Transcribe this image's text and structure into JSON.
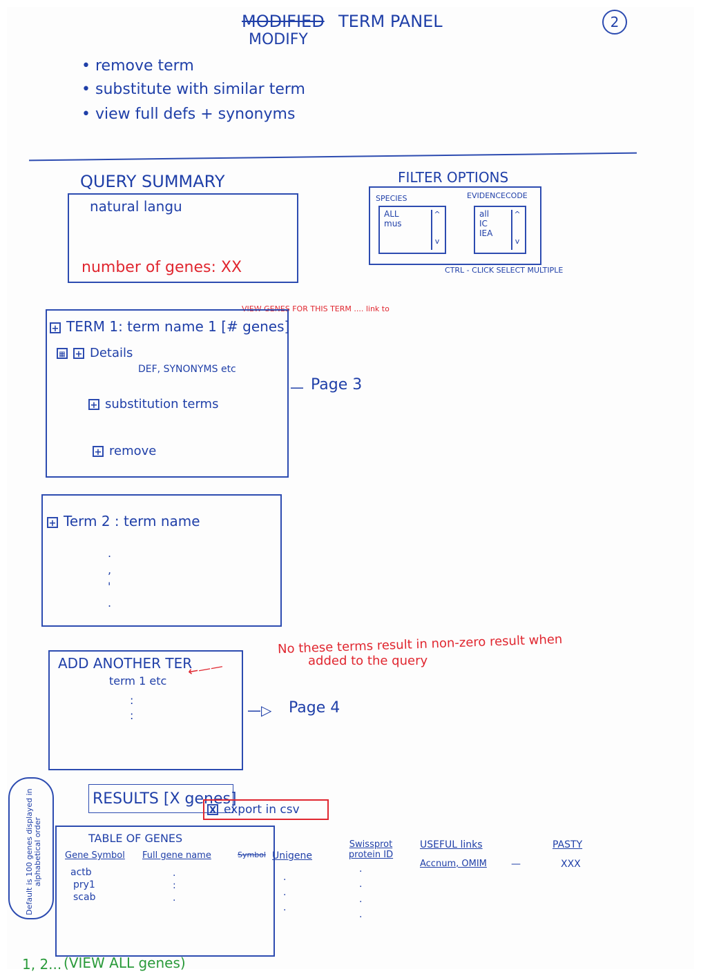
{
  "header": {
    "title_struck": "MODIFIED",
    "title_rest": "TERM PANEL",
    "subtitle": "MODIFY",
    "page_number": "2"
  },
  "notes": [
    "remove term",
    "substitute with similar term",
    "view full defs + synonyms"
  ],
  "query_summary": {
    "heading": "QUERY SUMMARY",
    "text": "natural langu",
    "gene_count": "number of genes: XX"
  },
  "filter_options": {
    "heading": "FILTER OPTIONS",
    "species_label": "SPECIES",
    "species_items": [
      "ALL",
      "mus"
    ],
    "evidence_label": "EVIDENCECODE",
    "evidence_items": [
      "all",
      "IC",
      "IEA"
    ],
    "hint": "CTRL - CLICK SELECT MULTIPLE"
  },
  "term1": {
    "expand": "+",
    "label": "TERM 1:  term name 1  [# genes]",
    "annotation": "VIEW GENES FOR THIS TERM .... link to",
    "details_label": "Details",
    "details_text": "DEF, SYNONYMS etc",
    "page_ref": "Page 3",
    "substitute_label": "substitution terms",
    "remove_label": "remove"
  },
  "term2": {
    "expand": "+",
    "label": "Term 2 :  term name"
  },
  "add_term": {
    "heading": "ADD ANOTHER TER",
    "item": "term 1 etc",
    "page_ref": "Page 4",
    "annotation_line1": "No these terms result in non-zero result when",
    "annotation_line2": "added to the query"
  },
  "results": {
    "heading": "RESULTS [X genes]",
    "export": "export in csv",
    "side_note": "Default is 100 genes displayed in alphabetical order",
    "table_title": "TABLE OF GENES",
    "columns": [
      "Gene Symbol",
      "Full gene name",
      "Symbol",
      "Unigene",
      "Swissprot protein ID",
      "USEFUL links",
      "PASTY"
    ],
    "symbols": [
      "actb",
      "pry1",
      "scab"
    ],
    "useful_links": "Accnum, OMIM",
    "pasty_value": "XXX",
    "pagination": "1, 2...",
    "view_all": "VIEW ALL genes"
  },
  "colors": {
    "ink": "#1f3fa8",
    "annotation": "#e0262f",
    "nav": "#2a9a3a"
  }
}
